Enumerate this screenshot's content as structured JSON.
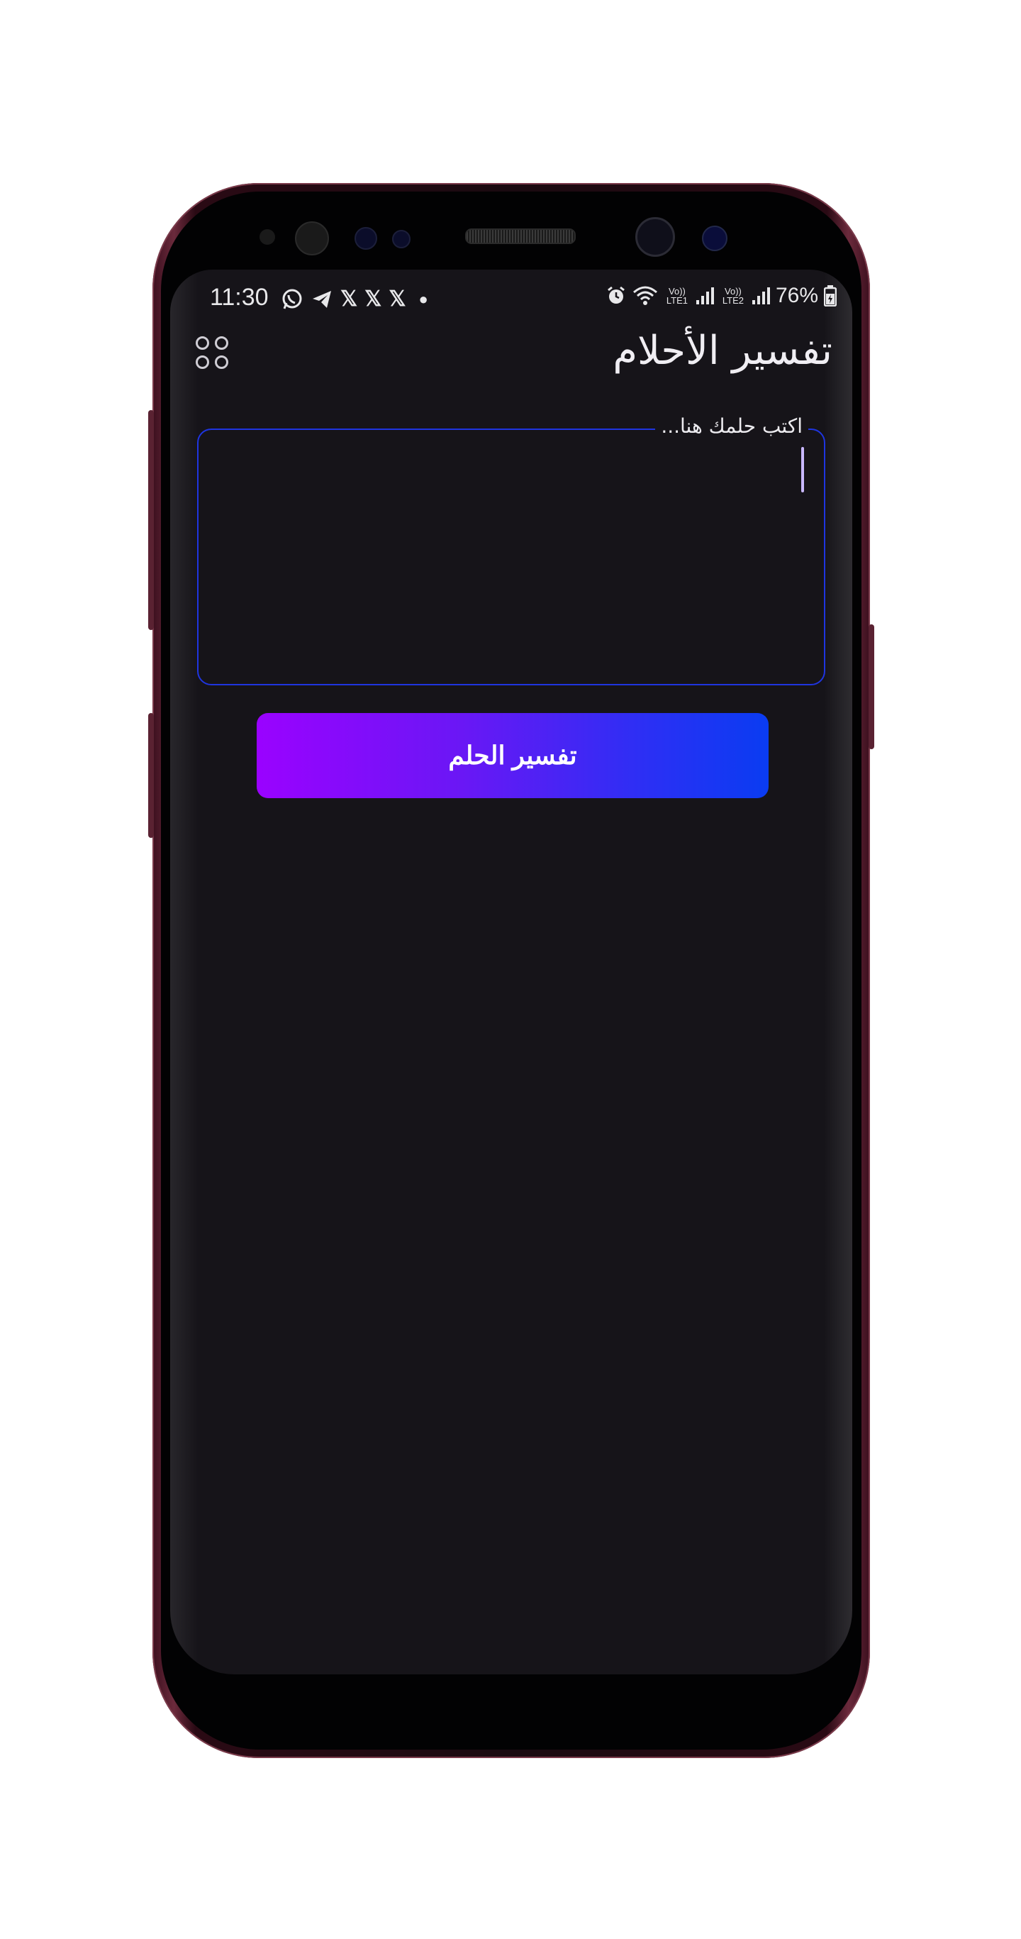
{
  "status_bar": {
    "time": "11:30",
    "battery": "76%",
    "volte1": "Vo)) LTE1",
    "volte2": "Vo)) LTE2",
    "left_icons": [
      "whatsapp-icon",
      "telegram-icon",
      "x-icon",
      "x-icon",
      "x-icon",
      "dot-icon"
    ],
    "right_icons": [
      "alarm-icon",
      "wifi-icon",
      "signal-icon",
      "signal-icon",
      "battery-icon"
    ]
  },
  "app": {
    "title": "تفسير الأحلام",
    "menu_icon": "menu-dots-icon"
  },
  "dream_input": {
    "label": "اكتب حلمك هنا...",
    "value": ""
  },
  "interpret_button": {
    "label": "تفسير الحلم"
  },
  "colors": {
    "background": "#161419",
    "field_border": "#1f35e0",
    "button_gradient_start": "#9a02ff",
    "button_gradient_end": "#0a3cf2",
    "caret": "#c9b8ff"
  }
}
